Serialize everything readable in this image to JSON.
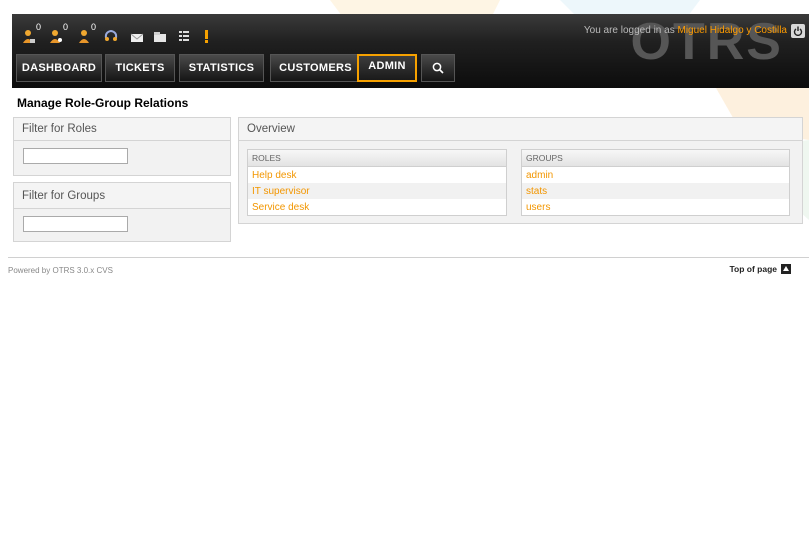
{
  "header": {
    "logo_text": "OTRS",
    "login_prefix": "You are logged in as",
    "user_name": "Miguel Hidalgo y Costilla",
    "toolbar_counts": [
      "0",
      "0",
      "0"
    ],
    "toolbar_icons": [
      "locked-tickets-icon",
      "watched-tickets-icon",
      "responsible-tickets-icon",
      "phone-ticket-icon",
      "email-ticket-icon",
      "search-ticket-icon",
      "queue-view-icon",
      "escalation-view-icon"
    ]
  },
  "nav": {
    "items": [
      "DASHBOARD",
      "TICKETS",
      "STATISTICS",
      "CUSTOMERS",
      "ADMIN"
    ],
    "active": "ADMIN"
  },
  "page": {
    "title": "Manage Role-Group Relations"
  },
  "sidebar": {
    "roles_filter_title": "Filter for Roles",
    "groups_filter_title": "Filter for Groups"
  },
  "overview": {
    "title": "Overview",
    "roles_header": "ROLES",
    "groups_header": "GROUPS",
    "roles": [
      "Help desk",
      "IT supervisor",
      "Service desk"
    ],
    "groups": [
      "admin",
      "stats",
      "users"
    ]
  },
  "footer": {
    "powered": "Powered by OTRS 3.0.x CVS",
    "top_of_page": "Top of page"
  },
  "colors": {
    "accent": "#f29600",
    "header_bg": "#1a1a1a"
  }
}
